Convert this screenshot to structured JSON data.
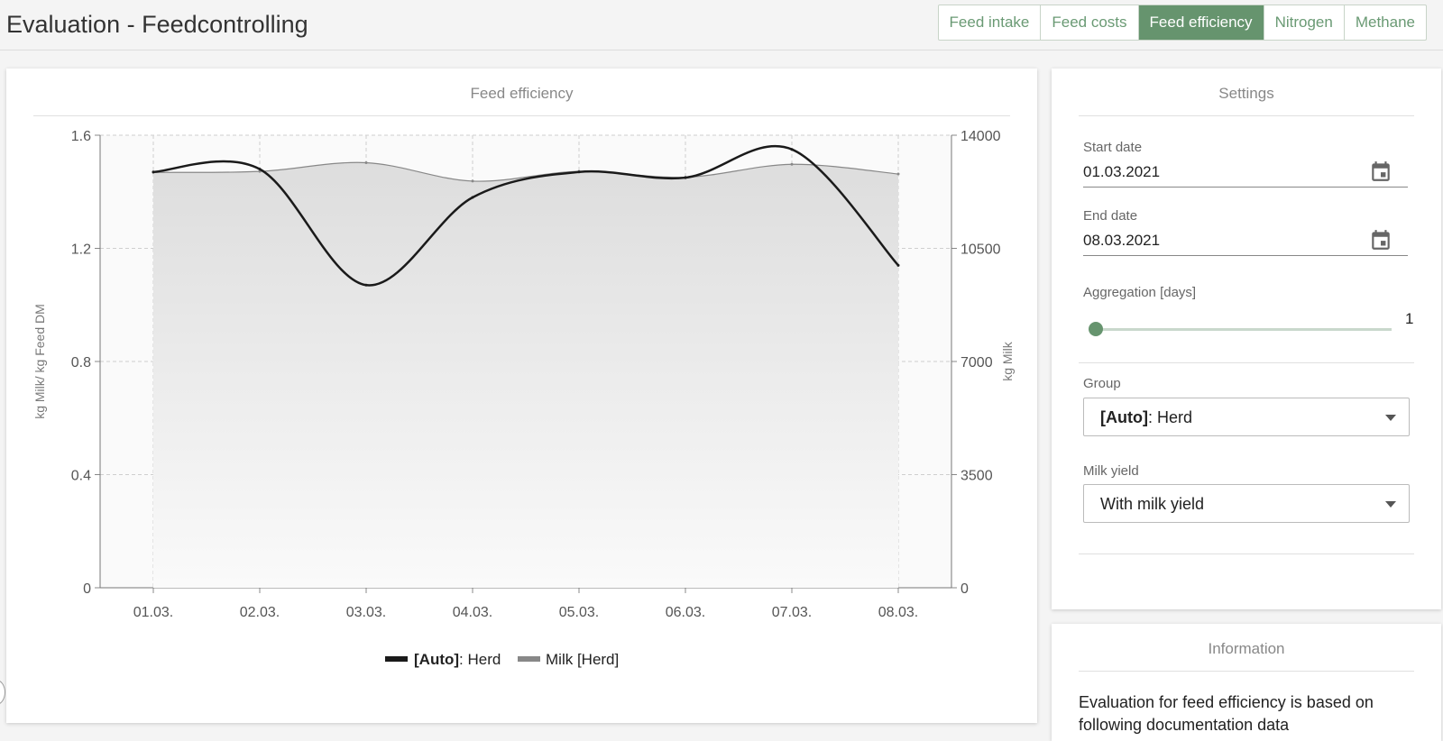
{
  "header": {
    "title": "Evaluation - Feedcontrolling",
    "tabs": [
      {
        "label": "Feed intake",
        "active": false
      },
      {
        "label": "Feed costs",
        "active": false
      },
      {
        "label": "Feed efficiency",
        "active": true
      },
      {
        "label": "Nitrogen",
        "active": false
      },
      {
        "label": "Methane",
        "active": false
      }
    ]
  },
  "chart_panel": {
    "title": "Feed efficiency"
  },
  "chart_data": {
    "type": "line",
    "categories": [
      "01.03.",
      "02.03.",
      "03.03.",
      "04.03.",
      "05.03.",
      "06.03.",
      "07.03.",
      "08.03."
    ],
    "ylabel": "kg Milk/ kg Feed DM",
    "ylabel_right": "kg Milk",
    "ylim": [
      0,
      1.6
    ],
    "ylim_right": [
      0,
      14000
    ],
    "yticks": [
      "0",
      "0.4",
      "0.8",
      "1.2",
      "1.6"
    ],
    "yticks_right": [
      "0",
      "3500",
      "7000",
      "10500",
      "14000"
    ],
    "grid": true,
    "legend_position": "bottom",
    "series": [
      {
        "name_prefix": "[Auto]",
        "name_suffix": ": Herd",
        "axis": "left",
        "style": "line",
        "color": "#1a1a1a",
        "values": [
          1.47,
          1.48,
          1.07,
          1.38,
          1.47,
          1.45,
          1.55,
          1.14
        ]
      },
      {
        "name": "Milk [Herd]",
        "axis": "right",
        "style": "area",
        "color": "#888888",
        "values": [
          12850,
          12880,
          13150,
          12580,
          12880,
          12700,
          13100,
          12800
        ]
      }
    ]
  },
  "settings": {
    "title": "Settings",
    "start_date_label": "Start date",
    "start_date_value": "01.03.2021",
    "end_date_label": "End date",
    "end_date_value": "08.03.2021",
    "aggregation_label": "Aggregation [days]",
    "aggregation_value": "1",
    "aggregation_level": 0,
    "group_label": "Group",
    "group_value_prefix": "[Auto]",
    "group_value_suffix": ": Herd",
    "milk_yield_label": "Milk yield",
    "milk_yield_value": "With milk yield"
  },
  "information": {
    "title": "Information",
    "text": "Evaluation for feed efficiency is based on following documentation data"
  },
  "colors": {
    "accent": "#66946e",
    "accent_light": "#c9d8cc"
  },
  "icons": {
    "calendar": "calendar-icon",
    "dropdown": "chevron-down-icon"
  }
}
